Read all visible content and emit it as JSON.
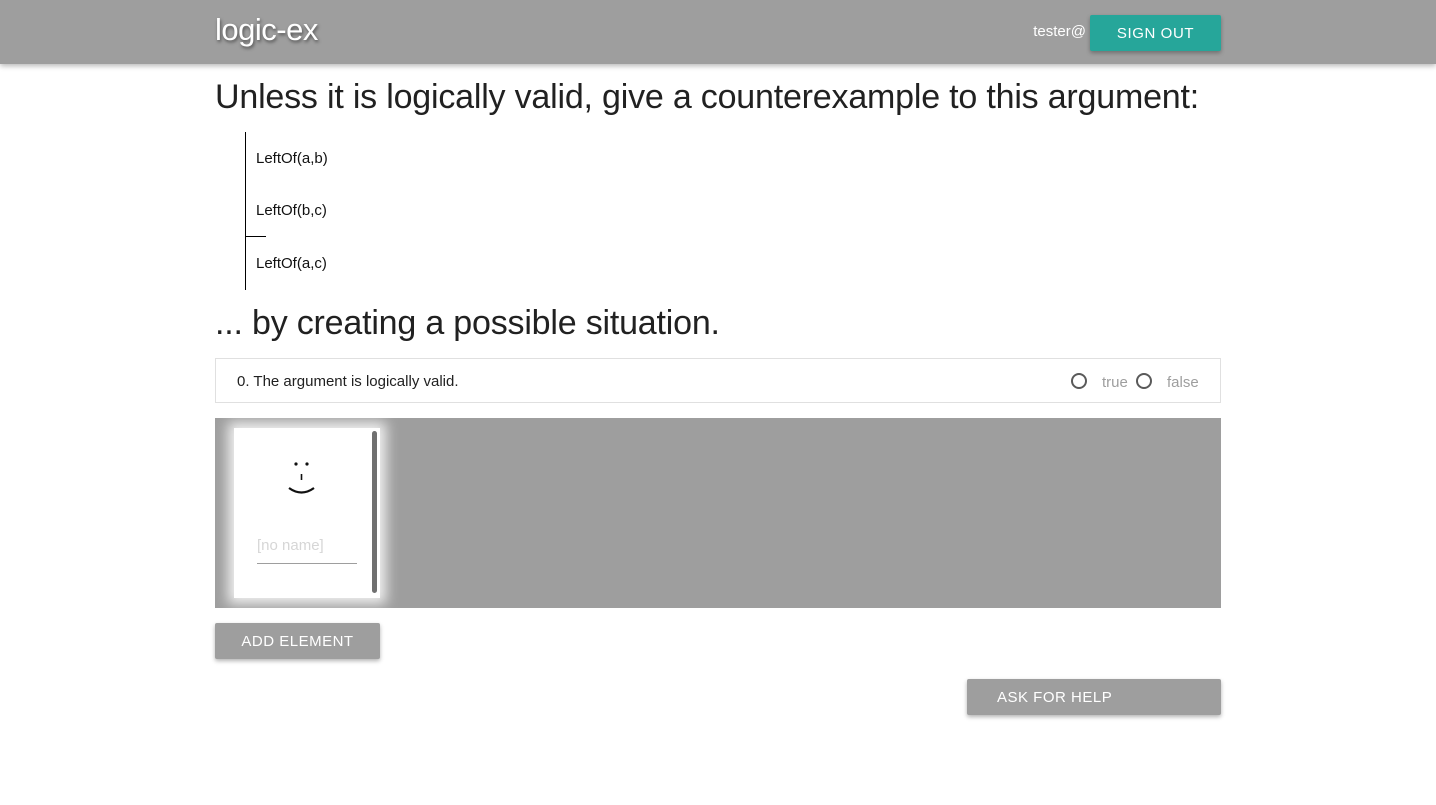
{
  "header": {
    "brand": "logic-ex",
    "user": "tester@",
    "sign_out_label": "SIGN OUT"
  },
  "question": {
    "instruction": "Unless it is logically valid, give a counterexample to this argument:",
    "premises": [
      "LeftOf(a,b)",
      "LeftOf(b,c)"
    ],
    "conclusion": "LeftOf(a,c)",
    "followup": "... by creating a possible situation."
  },
  "sentence": {
    "text": "0. The argument is logically valid.",
    "true_label": "true",
    "false_label": "false"
  },
  "situation": {
    "elements": [
      {
        "name_placeholder": "[no name]",
        "name_value": ""
      }
    ]
  },
  "buttons": {
    "add_element": "ADD ELEMENT",
    "ask_for_help": "ASK FOR HELP"
  }
}
